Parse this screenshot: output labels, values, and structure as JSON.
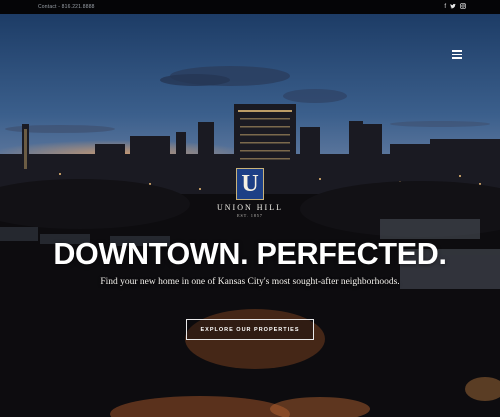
{
  "topbar": {
    "contact_text": "Contact - 816.221.8888",
    "social_icons": [
      "facebook-icon",
      "twitter-icon",
      "instagram-icon"
    ],
    "social_glyphs": [
      "f",
      "🐦",
      "◎"
    ]
  },
  "nav": {
    "menu_icon": "hamburger-menu-icon"
  },
  "logo": {
    "letter": "U",
    "name": "UNION HILL",
    "est": "EST. 1857"
  },
  "hero": {
    "headline": "DOWNTOWN. PERFECTED.",
    "subheadline": "Find your new home in one of Kansas City's most sought-after neighborhoods.",
    "cta_label": "EXPLORE OUR PROPERTIES"
  },
  "colors": {
    "logo_blue": "#1c3f86",
    "logo_gold": "#c8b27a",
    "topbar": "#050507"
  }
}
